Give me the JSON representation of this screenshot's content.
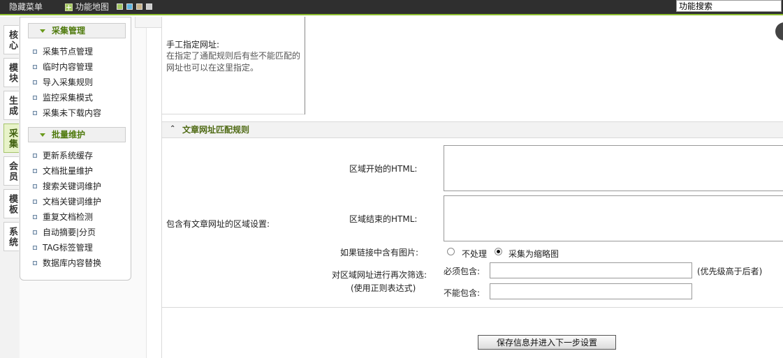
{
  "topbar": {
    "hide_menu": "隐藏菜单",
    "site_map": "功能地图",
    "search_value": "功能搜索",
    "skin_colors": [
      "#a3c862",
      "#5fb5e0",
      "#c8b28a",
      "#cccccc"
    ]
  },
  "left_tabs": [
    {
      "label": "核心"
    },
    {
      "label": "模块"
    },
    {
      "label": "生成"
    },
    {
      "label": "采集",
      "active": true
    },
    {
      "label": "会员"
    },
    {
      "label": "模板"
    },
    {
      "label": "系统"
    }
  ],
  "menu": {
    "sections": [
      {
        "title": "采集管理",
        "items": [
          "采集节点管理",
          "临时内容管理",
          "导入采集规则",
          "监控采集模式",
          "采集未下载内容"
        ]
      },
      {
        "title": "批量维护",
        "items": [
          "更新系统缓存",
          "文档批量维护",
          "搜索关键词维护",
          "文档关键词维护",
          "重复文档检测",
          "自动摘要|分页",
          "TAG标签管理",
          "数据库内容替换"
        ]
      }
    ]
  },
  "form": {
    "manual_url_title": "手工指定网址:",
    "manual_url_help": "在指定了通配规则后有些不能匹配的网址也可以在这里指定。",
    "section_title": "文章网址匹配规则",
    "region_label": "包含有文章网址的区域设置:",
    "region_start_label": "区域开始的HTML:",
    "region_end_label": "区域结束的HTML:",
    "image_link_label": "如果链接中含有图片:",
    "radio_no_process": "不处理",
    "radio_thumbnail": "采集为缩略图",
    "refilter_label": "对区域网址进行再次筛选:",
    "refilter_sub": "(使用正则表达式)",
    "must_include": "必须包含:",
    "priority_note": "(优先级高于后者)",
    "cannot_include": "不能包含:",
    "save_button": "保存信息并进入下一步设置"
  }
}
